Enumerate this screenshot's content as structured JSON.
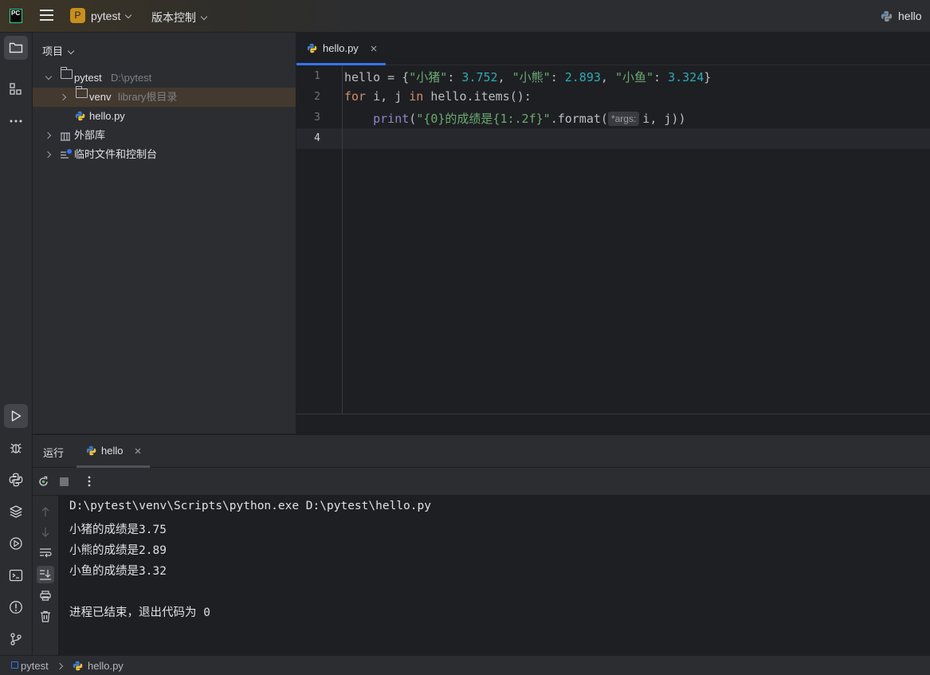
{
  "titlebar": {
    "app_logo_text": "PC",
    "project_badge": "P",
    "project_name": "pytest",
    "vcs_menu": "版本控制",
    "run_config": "hello"
  },
  "project_panel": {
    "header": "项目",
    "tree": [
      {
        "label": "pytest",
        "detail": "D:\\pytest"
      },
      {
        "label": "venv",
        "detail": "library根目录"
      },
      {
        "label": "hello.py",
        "detail": ""
      },
      {
        "label": "外部库",
        "detail": ""
      },
      {
        "label": "临时文件和控制台",
        "detail": ""
      }
    ]
  },
  "editor": {
    "tab_label": "hello.py",
    "line_numbers": [
      "1",
      "2",
      "3",
      "4"
    ],
    "hint_label": "*args:"
  },
  "run_panel": {
    "title": "运行",
    "tab_label": "hello",
    "console": [
      "D:\\pytest\\venv\\Scripts\\python.exe D:\\pytest\\hello.py",
      "小猪的成绩是3.75",
      "小熊的成绩是2.89",
      "小鱼的成绩是3.32",
      "",
      "进程已结束，退出代码为 0"
    ]
  },
  "statusbar": {
    "breadcrumb_project": "pytest",
    "breadcrumb_file": "hello.py"
  },
  "colors": {
    "accent": "#3574f0",
    "keyword": "#cf8e6d",
    "string": "#6aab73",
    "number": "#2aacb8",
    "builtin": "#8888c6"
  }
}
